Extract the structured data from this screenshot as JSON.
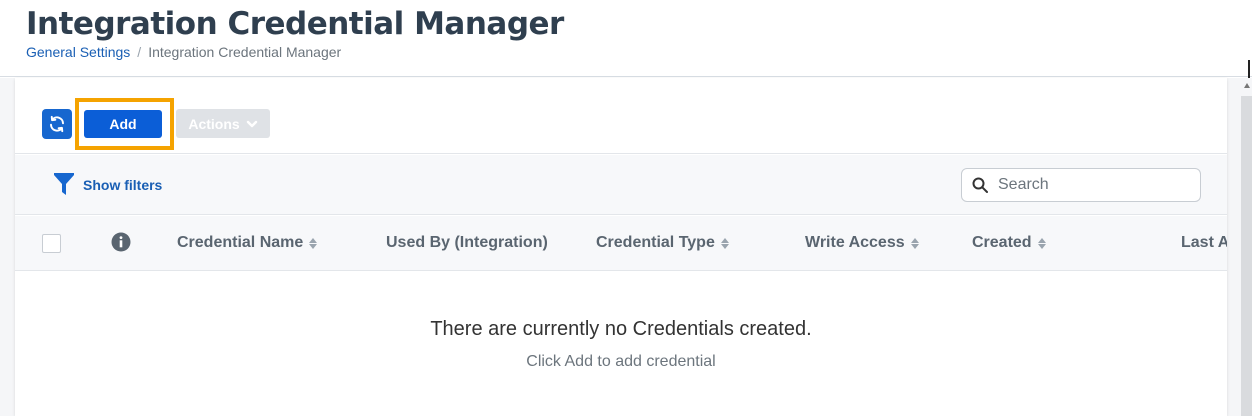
{
  "header": {
    "title": "Integration Credential Manager",
    "breadcrumb": {
      "parent": "General Settings",
      "separator": "/",
      "current": "Integration Credential Manager"
    }
  },
  "toolbar": {
    "refresh_icon": "refresh-icon",
    "add_label": "Add",
    "actions_label": "Actions",
    "highlight_color": "#f5a300",
    "primary_color": "#0b5ed7"
  },
  "filters": {
    "show_filters_label": "Show filters",
    "filter_icon": "funnel-icon"
  },
  "search": {
    "placeholder": "Search",
    "value": ""
  },
  "table": {
    "columns": [
      "Credential Name",
      "Used By (Integration)",
      "Credential Type",
      "Write Access",
      "Created",
      "Last A"
    ]
  },
  "empty_state": {
    "title": "There are currently no Credentials created.",
    "subtitle": "Click Add to add credential"
  }
}
